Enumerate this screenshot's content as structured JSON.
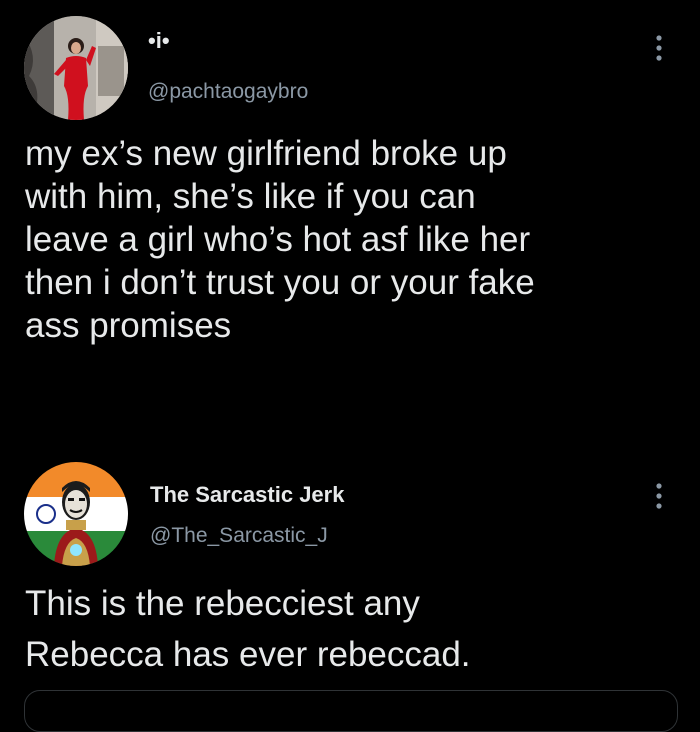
{
  "tweets": [
    {
      "display_name": "•i•",
      "handle": "@pachtaogaybro",
      "avatar_icon": "woman-in-red-dress-avatar",
      "more_icon": "more-vertical-icon",
      "text_lines": [
        "my ex’s new girlfriend broke up",
        "with him, she’s like if you can",
        "leave a girl who’s hot asf like her",
        "then i don’t trust you or your fake",
        "ass promises"
      ]
    },
    {
      "display_name": "The Sarcastic Jerk",
      "handle": "@The_Sarcastic_J",
      "avatar_icon": "iron-man-indian-flag-avatar",
      "more_icon": "more-vertical-icon",
      "text_lines": [
        "This is the rebecciest any",
        "Rebecca has ever rebeccad."
      ]
    }
  ],
  "colors": {
    "background": "#000000",
    "primary_text": "#e7e9ea",
    "secondary_text": "#8b98a5",
    "divider": "#2f3336"
  }
}
